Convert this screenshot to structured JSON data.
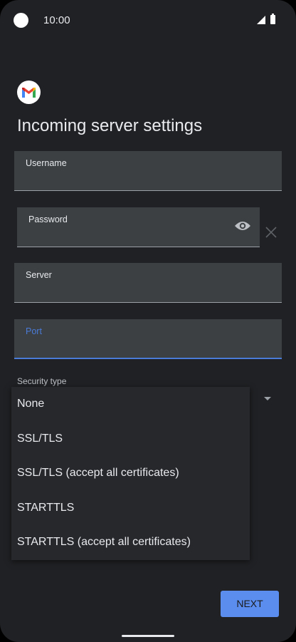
{
  "status_bar": {
    "time": "10:00"
  },
  "page": {
    "title": "Incoming server settings"
  },
  "fields": {
    "username": {
      "label": "Username"
    },
    "password": {
      "label": "Password"
    },
    "server": {
      "label": "Server"
    },
    "port": {
      "label": "Port"
    }
  },
  "security": {
    "label": "Security type",
    "options": [
      "None",
      "SSL/TLS",
      "SSL/TLS (accept all certificates)",
      "STARTTLS",
      "STARTTLS (accept all certificates)"
    ]
  },
  "buttons": {
    "next": "NEXT"
  },
  "colors": {
    "background": "#202124",
    "field": "#3c4043",
    "accent": "#5b8def",
    "focus": "#4a7bd8"
  },
  "icons": [
    "gmail-logo-icon",
    "eye-icon",
    "close-icon",
    "dropdown-arrow-icon",
    "signal-icon",
    "battery-icon"
  ]
}
